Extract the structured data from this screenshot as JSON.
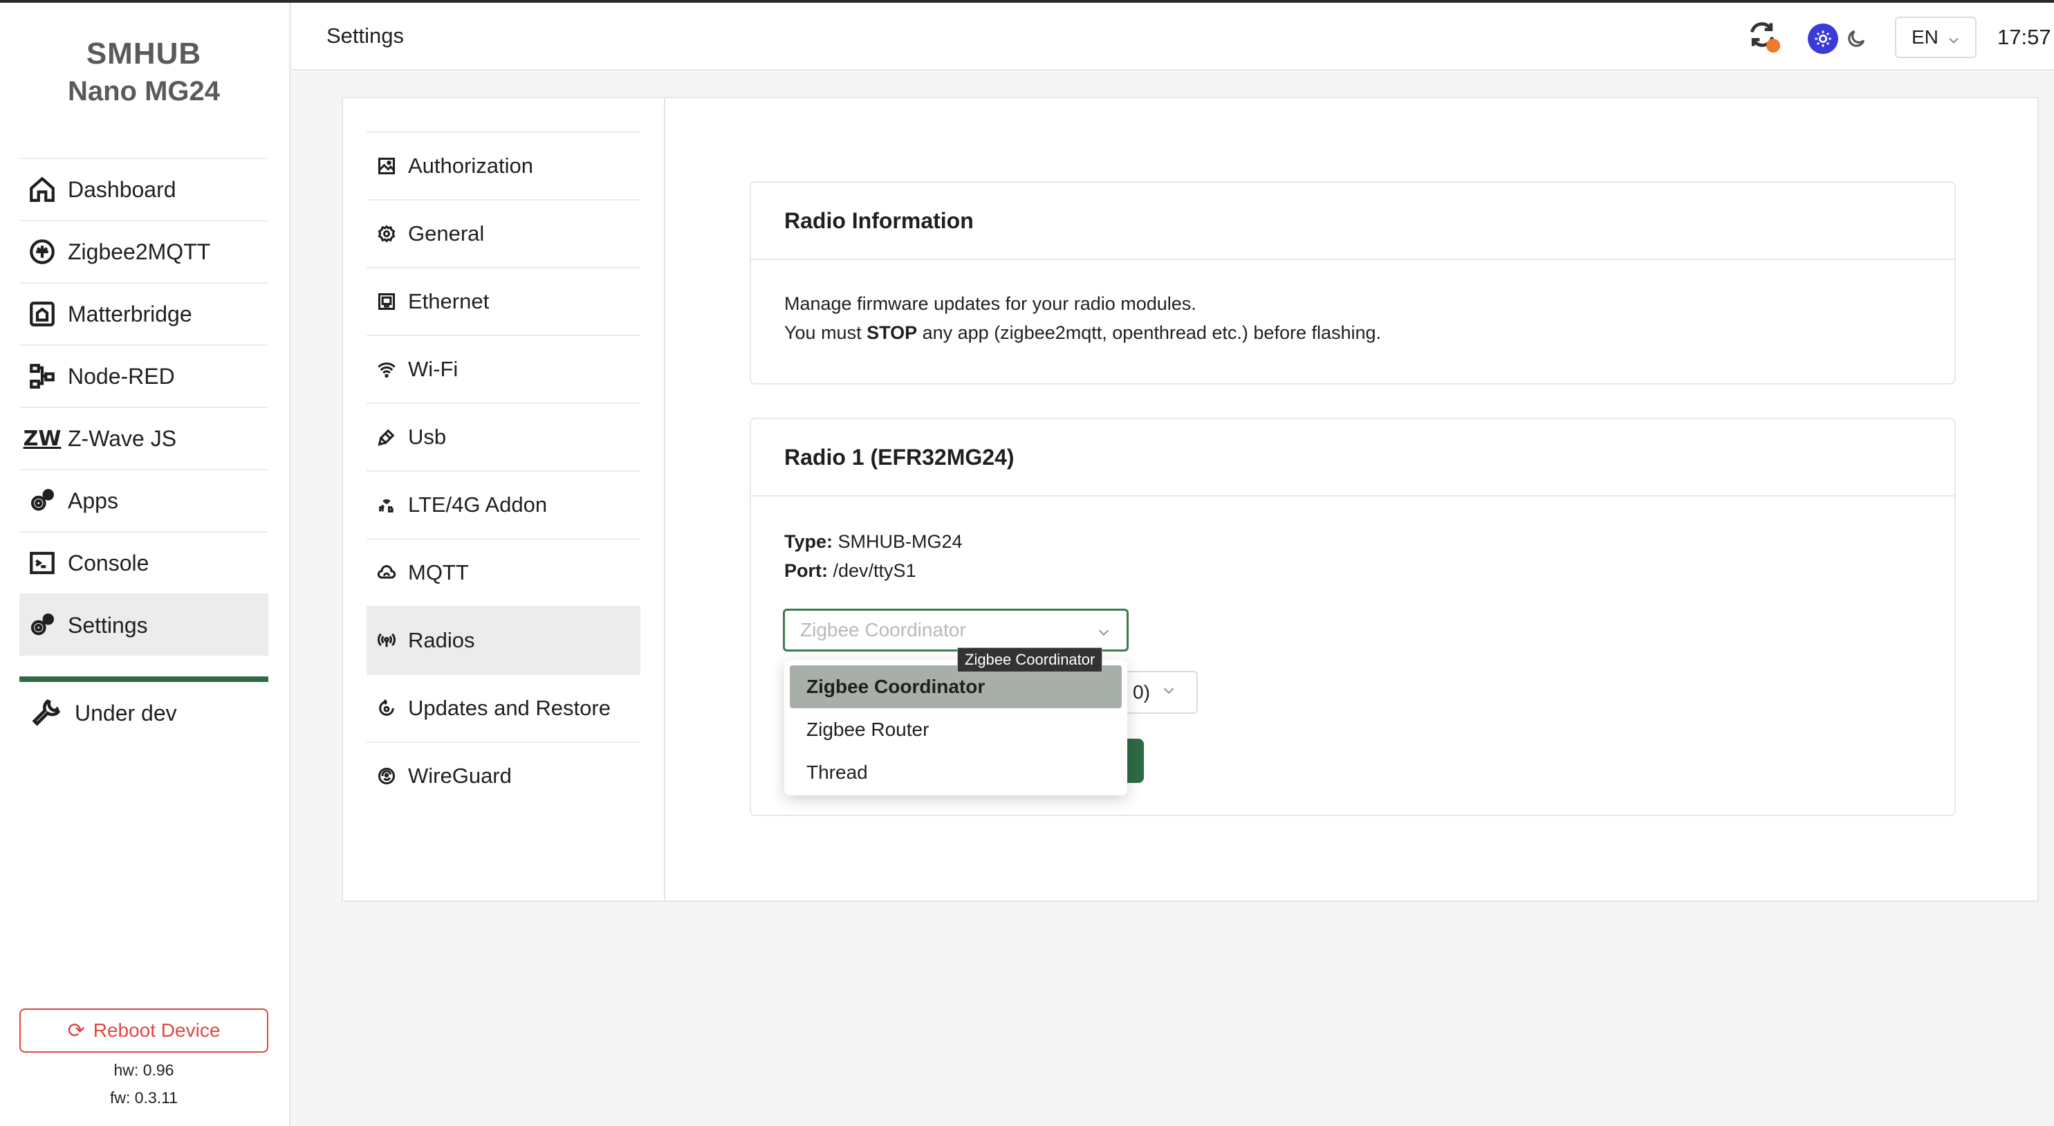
{
  "brand": {
    "line1": "SMHUB",
    "line2": "Nano MG24"
  },
  "sidebar": {
    "items": [
      {
        "label": "Dashboard",
        "icon": "home-icon"
      },
      {
        "label": "Zigbee2MQTT",
        "icon": "zigbee-icon"
      },
      {
        "label": "Matterbridge",
        "icon": "matter-icon"
      },
      {
        "label": "Node-RED",
        "icon": "node-red-icon"
      },
      {
        "label": "Z-Wave JS",
        "icon": "zwave-icon",
        "glyph": "ZW"
      },
      {
        "label": "Apps",
        "icon": "gears-icon"
      },
      {
        "label": "Console",
        "icon": "terminal-icon"
      },
      {
        "label": "Settings",
        "icon": "gears-icon"
      }
    ],
    "active": "Settings",
    "under_dev": "Under dev",
    "reboot_label": "Reboot Device",
    "hw": "hw: 0.96",
    "fw": "fw: 0.3.11",
    "accent_color": "#2e6b45",
    "danger_color": "#e0473f"
  },
  "header": {
    "title": "Settings",
    "language": "EN",
    "time": "17:57",
    "sync_badge_color": "#f07a2b",
    "theme_active_color": "#3a3ad8"
  },
  "settings_menu": {
    "items": [
      {
        "label": "Authorization",
        "icon": "image-icon"
      },
      {
        "label": "General",
        "icon": "gear-icon"
      },
      {
        "label": "Ethernet",
        "icon": "ethernet-icon"
      },
      {
        "label": "Wi-Fi",
        "icon": "wifi-icon"
      },
      {
        "label": "Usb",
        "icon": "usb-icon"
      },
      {
        "label": "LTE/4G Addon",
        "icon": "lte-icon"
      },
      {
        "label": "MQTT",
        "icon": "cloud-icon"
      },
      {
        "label": "Radios",
        "icon": "antenna-icon"
      },
      {
        "label": "Updates and Restore",
        "icon": "update-icon"
      },
      {
        "label": "WireGuard",
        "icon": "wireguard-icon"
      }
    ],
    "active": "Radios"
  },
  "radio_info": {
    "title": "Radio Information",
    "line1": "Manage firmware updates for your radio modules.",
    "line2_prefix": "You must ",
    "line2_bold": "STOP",
    "line2_suffix": " any app (zigbee2mqtt, openthread etc.) before flashing."
  },
  "radio1": {
    "title": "Radio 1 (EFR32MG24)",
    "type_label": "Type:",
    "type_value": "SMHUB-MG24",
    "port_label": "Port:",
    "port_value": "/dev/ttyS1",
    "select_value": "Zigbee Coordinator",
    "secondary_select_partial": "0)",
    "tooltip": "Zigbee Coordinator",
    "options": [
      "Zigbee Coordinator",
      "Zigbee Router",
      "Thread"
    ],
    "selected_option": "Zigbee Coordinator"
  }
}
